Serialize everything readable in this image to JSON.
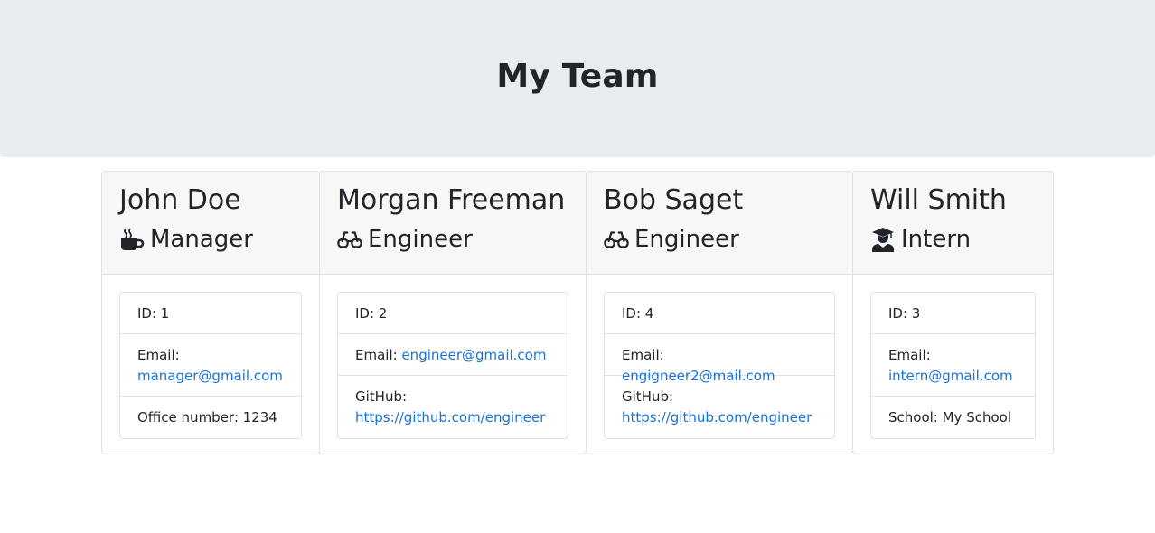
{
  "header": {
    "title": "My Team"
  },
  "members": [
    {
      "name": "John Doe",
      "role": "Manager",
      "icon": "mug-icon",
      "id_label": "ID: 1",
      "email_label": "Email:",
      "email": "manager@gmail.com",
      "extra_label": "Office number: 1234"
    },
    {
      "name": "Morgan Freeman",
      "role": "Engineer",
      "icon": "glasses-icon",
      "id_label": "ID: 2",
      "email_label": "Email:",
      "email": "engineer@gmail.com",
      "extra_label": "GitHub:",
      "extra_link": "https://github.com/engineer"
    },
    {
      "name": "Bob Saget",
      "role": "Engineer",
      "icon": "glasses-icon",
      "id_label": "ID: 4",
      "email_label": "Email:",
      "email": "engigneer2@mail.com",
      "extra_label": "GitHub:",
      "extra_link": "https://github.com/engineer"
    },
    {
      "name": "Will Smith",
      "role": "Intern",
      "icon": "graduate-icon",
      "id_label": "ID: 3",
      "email_label": "Email:",
      "email": "intern@gmail.com",
      "extra_label": "School: My School"
    }
  ]
}
